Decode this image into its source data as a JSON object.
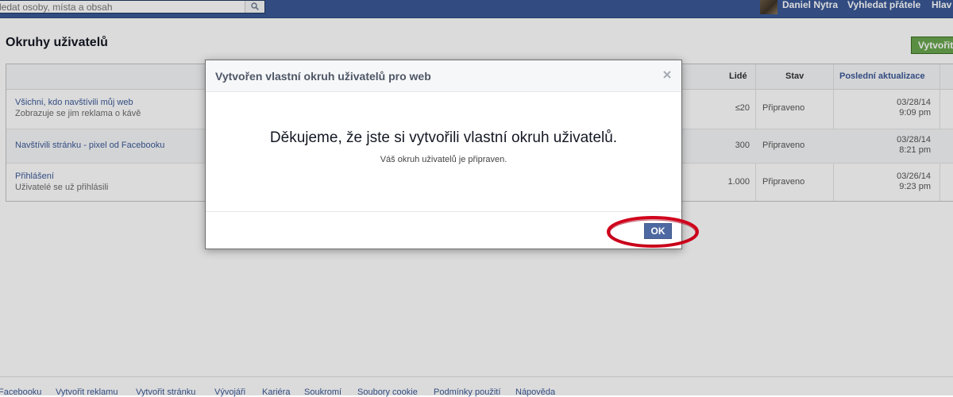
{
  "header": {
    "search_text": "ledat osoby, místa a obsah",
    "user_name": "Daniel Nytra",
    "find_friends": "Vyhledat přátele",
    "home": "Hlav"
  },
  "page": {
    "title": "Okruhy uživatelů",
    "create_button": "Vytvořit"
  },
  "table": {
    "columns": {
      "people": "Lidé",
      "status": "Stav",
      "last_update": "Poslední aktualizace"
    },
    "rows": [
      {
        "name": "Všichni, kdo navštívili můj web",
        "desc": "Zobrazuje se jim reklama o kávě",
        "people": "≤20",
        "status": "Připraveno",
        "date": "03/28/14",
        "time": "9:09 pm"
      },
      {
        "name": "Navštívili stránku - pixel od Facebooku",
        "desc": "",
        "people": "300",
        "status": "Připraveno",
        "date": "03/28/14",
        "time": "8:21 pm"
      },
      {
        "name": "Přihlášení",
        "desc": "Uživatelé se už přihlásili",
        "people": "1.000",
        "status": "Připraveno",
        "date": "03/26/14",
        "time": "9:23 pm"
      }
    ]
  },
  "dialog": {
    "title": "Vytvořen vlastní okruh uživatelů pro web",
    "message": "Děkujeme, že jste si vytvořili vlastní okruh uživatelů.",
    "submessage": "Váš okruh uživatelů je připraven.",
    "ok_label": "OK"
  },
  "footer": {
    "links": [
      "Facebooku",
      "Vytvořit reklamu",
      "Vytvořit stránku",
      "Vývojáři",
      "Kariéra",
      "Soukromí",
      "Soubory cookie",
      "Podmínky použití",
      "Nápověda"
    ]
  },
  "colors": {
    "topbar": "#3b5998",
    "create_button": "#69a74e",
    "ok_button": "#4e69a2",
    "highlight_ring": "#d0021b"
  }
}
